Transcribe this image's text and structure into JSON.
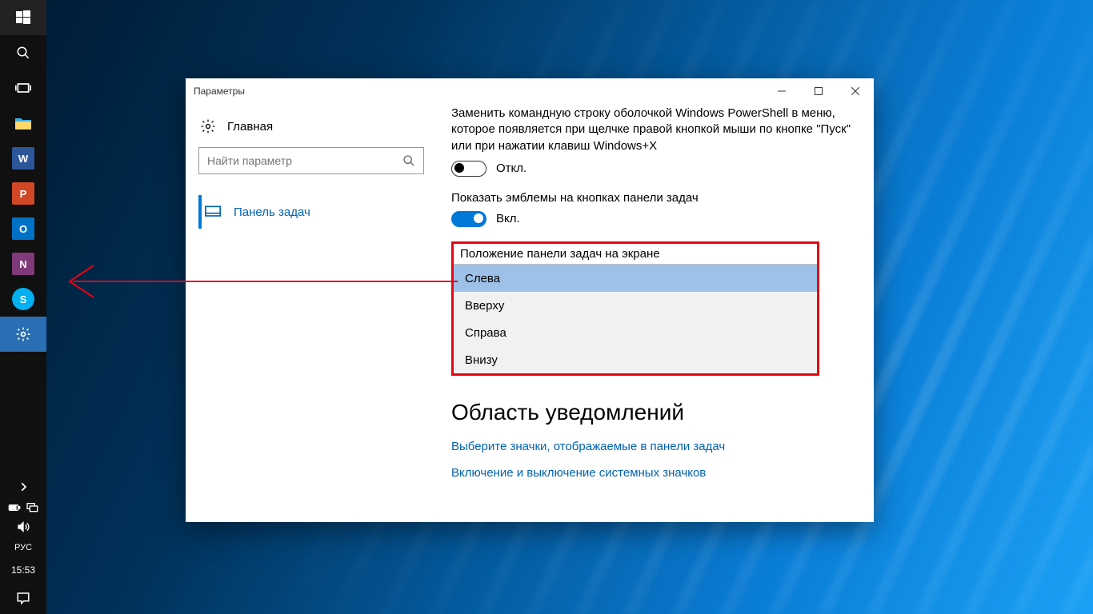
{
  "taskbar": {
    "apps": [
      {
        "name": "word",
        "label": "W",
        "bg": "#2b579a"
      },
      {
        "name": "powerpoint",
        "label": "P",
        "bg": "#d24726"
      },
      {
        "name": "outlook",
        "label": "O",
        "bg": "#0072c6"
      },
      {
        "name": "onenote",
        "label": "N",
        "bg": "#80397b"
      },
      {
        "name": "skype",
        "label": "S",
        "bg": "#00aff0"
      }
    ],
    "lang": "РУС",
    "time": "15:53"
  },
  "window": {
    "title": "Параметры",
    "home": "Главная",
    "search_placeholder": "Найти параметр",
    "category": "Панель задач"
  },
  "settings": {
    "powershell_desc": "Заменить командную строку оболочкой Windows PowerShell в меню, которое появляется при щелчке правой кнопкой мыши по кнопке \"Пуск\" или при нажатии клавиш Windows+X",
    "off_label": "Откл.",
    "badges_desc": "Показать эмблемы на кнопках панели задач",
    "on_label": "Вкл.",
    "position_label": "Положение панели задач на экране",
    "position_options": {
      "left": "Слева",
      "top": "Вверху",
      "right": "Справа",
      "bottom": "Внизу"
    },
    "notif_heading": "Область уведомлений",
    "link_icons": "Выберите значки, отображаемые в панели задач",
    "link_sysicons": "Включение и выключение системных значков"
  }
}
